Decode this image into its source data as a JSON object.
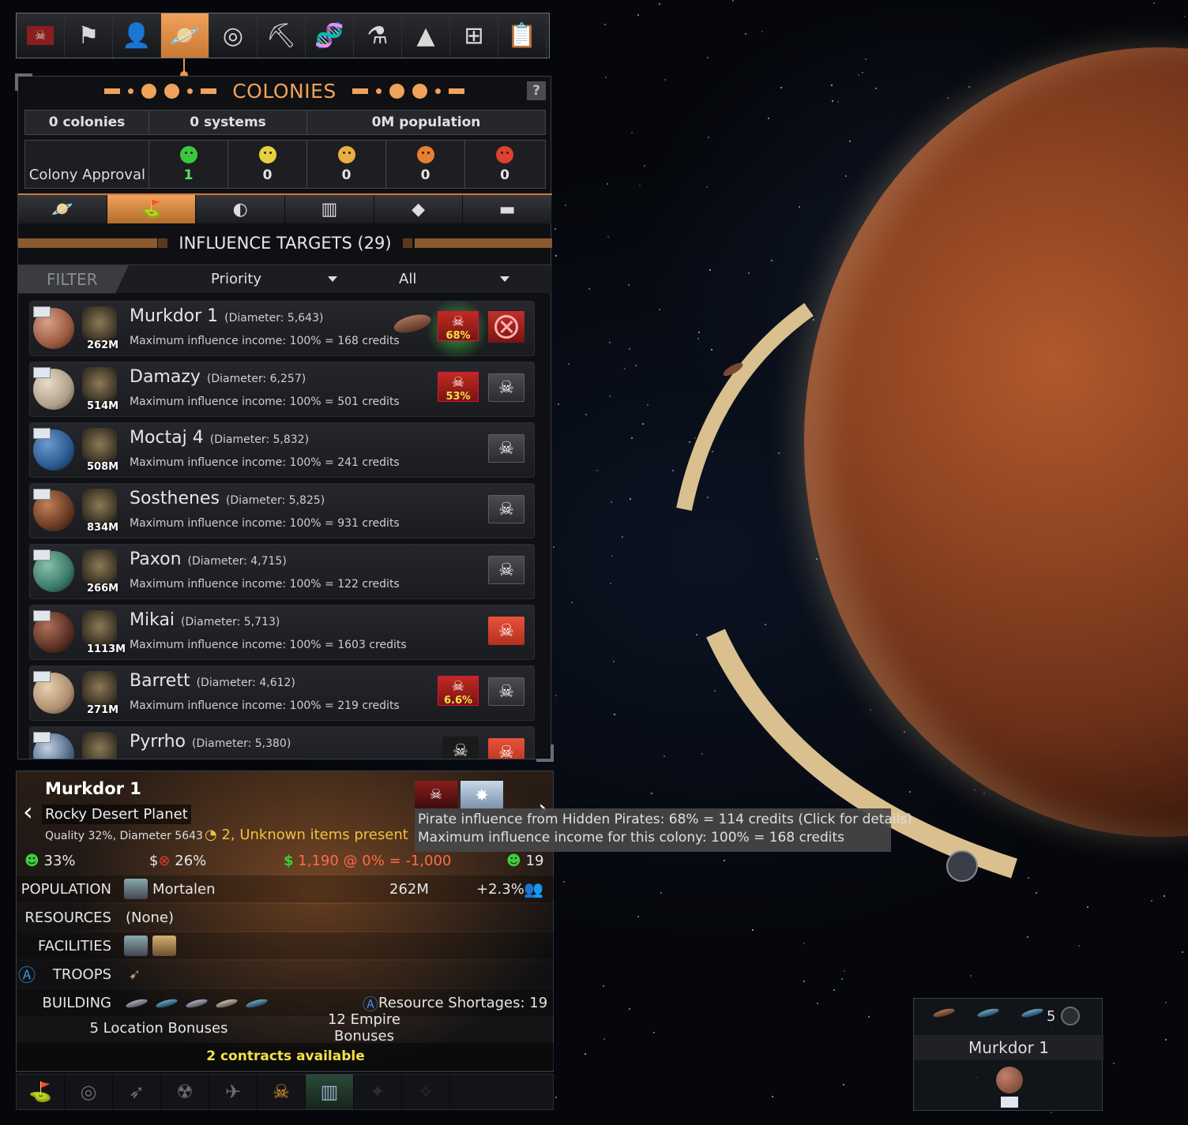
{
  "colors": {
    "accent": "#f0a25a",
    "good": "#3cd03c",
    "bad": "#e03a2a",
    "warn": "#f3e04a"
  },
  "topbar": {
    "icons": [
      "pirate-flag-icon",
      "crossed-flags-icon",
      "person-icon",
      "colonies-icon",
      "radar-icon",
      "pickaxe-icon",
      "dna-icon",
      "flask-icon",
      "fleet-icon",
      "grid-icon",
      "clipboard-check-icon"
    ],
    "active": "colonies-icon"
  },
  "colonies": {
    "title": "COLONIES",
    "help": "?",
    "summary": {
      "colonies": "0 colonies",
      "systems": "0 systems",
      "population": "0M population"
    },
    "approval": {
      "label": "Colony Approval",
      "values": [
        "1",
        "0",
        "0",
        "0",
        "0"
      ]
    },
    "subtabs": [
      "planet-icon",
      "flag-planet-icon",
      "globe-icon",
      "tower-icon",
      "gem-icon",
      "cargo-icon"
    ],
    "influence_title": "INFLUENCE TARGETS (29)",
    "filter": {
      "label": "FILTER",
      "priority": "Priority",
      "all": "All"
    },
    "targets": [
      {
        "name": "Murkdor 1",
        "diameter": "(Diameter: 5,643)",
        "income": "Maximum influence income: 100% = 168 credits",
        "pop": "262M",
        "pct": "68%"
      },
      {
        "name": "Damazy",
        "diameter": "(Diameter: 6,257)",
        "income": "Maximum influence income: 100% = 501 credits",
        "pop": "514M",
        "pct": "53%"
      },
      {
        "name": "Moctaj 4",
        "diameter": "(Diameter: 5,832)",
        "income": "Maximum influence income: 100% = 241 credits",
        "pop": "508M"
      },
      {
        "name": "Sosthenes",
        "diameter": "(Diameter: 5,825)",
        "income": "Maximum influence income: 100% = 931 credits",
        "pop": "834M"
      },
      {
        "name": "Paxon",
        "diameter": "(Diameter: 4,715)",
        "income": "Maximum influence income: 100% = 122 credits",
        "pop": "266M"
      },
      {
        "name": "Mikai",
        "diameter": "(Diameter: 5,713)",
        "income": "Maximum influence income: 100% = 1603 credits",
        "pop": "1113M"
      },
      {
        "name": "Barrett",
        "diameter": "(Diameter: 4,612)",
        "income": "Maximum influence income: 100% = 219 credits",
        "pop": "271M",
        "pct": "6.6%"
      },
      {
        "name": "Pyrrho",
        "diameter": "(Diameter: 5,380)"
      }
    ]
  },
  "detail": {
    "name": "Murkdor 1",
    "type": "Rocky Desert Planet",
    "quality": "Quality 32%, Diameter 5643",
    "unknown": "2, Unknown items present",
    "happiness": "33%",
    "corruption": "26%",
    "income": "1,190 @ 0% = -1,000",
    "approval": "19",
    "population_label": "POPULATION",
    "race": "Mortalen",
    "population": "262M",
    "growth": "+2.3%",
    "resources_label": "RESOURCES",
    "resources": "(None)",
    "facilities_label": "FACILITIES",
    "troops_label": "TROOPS",
    "building_label": "BUILDING",
    "shortages": "Resource Shortages: 19",
    "location_bonuses": "5 Location Bonuses",
    "empire_bonuses": "12 Empire Bonuses",
    "contracts": "2 contracts available"
  },
  "iconbar": [
    "flag-planet-icon",
    "target-icon",
    "missile-icon",
    "robot-icon",
    "satellite-icon",
    "pirate-face-icon",
    "tower-icon",
    "ship-icon",
    "shuttle-icon",
    "blank-icon"
  ],
  "tooltip": {
    "line1": "Pirate influence from Hidden Pirates: 68% = 114 credits (Click for details)",
    "line2": "Maximum influence income for this colony: 100% = 168 credits"
  },
  "card": {
    "count": "5",
    "name": "Murkdor 1"
  }
}
